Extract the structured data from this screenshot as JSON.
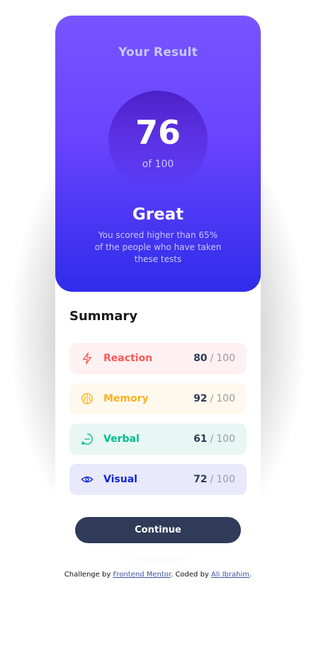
{
  "result": {
    "title": "Your Result",
    "score": "76",
    "score_max": "of 100",
    "grade": "Great",
    "description": "You scored higher than 65% of the people who have taken these tests"
  },
  "summary": {
    "title": "Summary",
    "items": [
      {
        "label": "Reaction",
        "score": "80",
        "max": "100",
        "icon": "lightning-icon",
        "color": "#FF5757"
      },
      {
        "label": "Memory",
        "score": "92",
        "max": "100",
        "icon": "brain-icon",
        "color": "#FFB01F"
      },
      {
        "label": "Verbal",
        "score": "61",
        "max": "100",
        "icon": "chat-bubble-icon",
        "color": "#00BB8F"
      },
      {
        "label": "Visual",
        "score": "72",
        "max": "100",
        "icon": "eye-icon",
        "color": "#1125D6"
      }
    ],
    "slash": "/"
  },
  "button": {
    "label": "Continue"
  },
  "attribution": {
    "prefix": "Challenge by ",
    "link1": "Frontend Mentor",
    "middle": ". Coded by ",
    "link2": "Ali Ibrahim",
    "suffix": "."
  }
}
